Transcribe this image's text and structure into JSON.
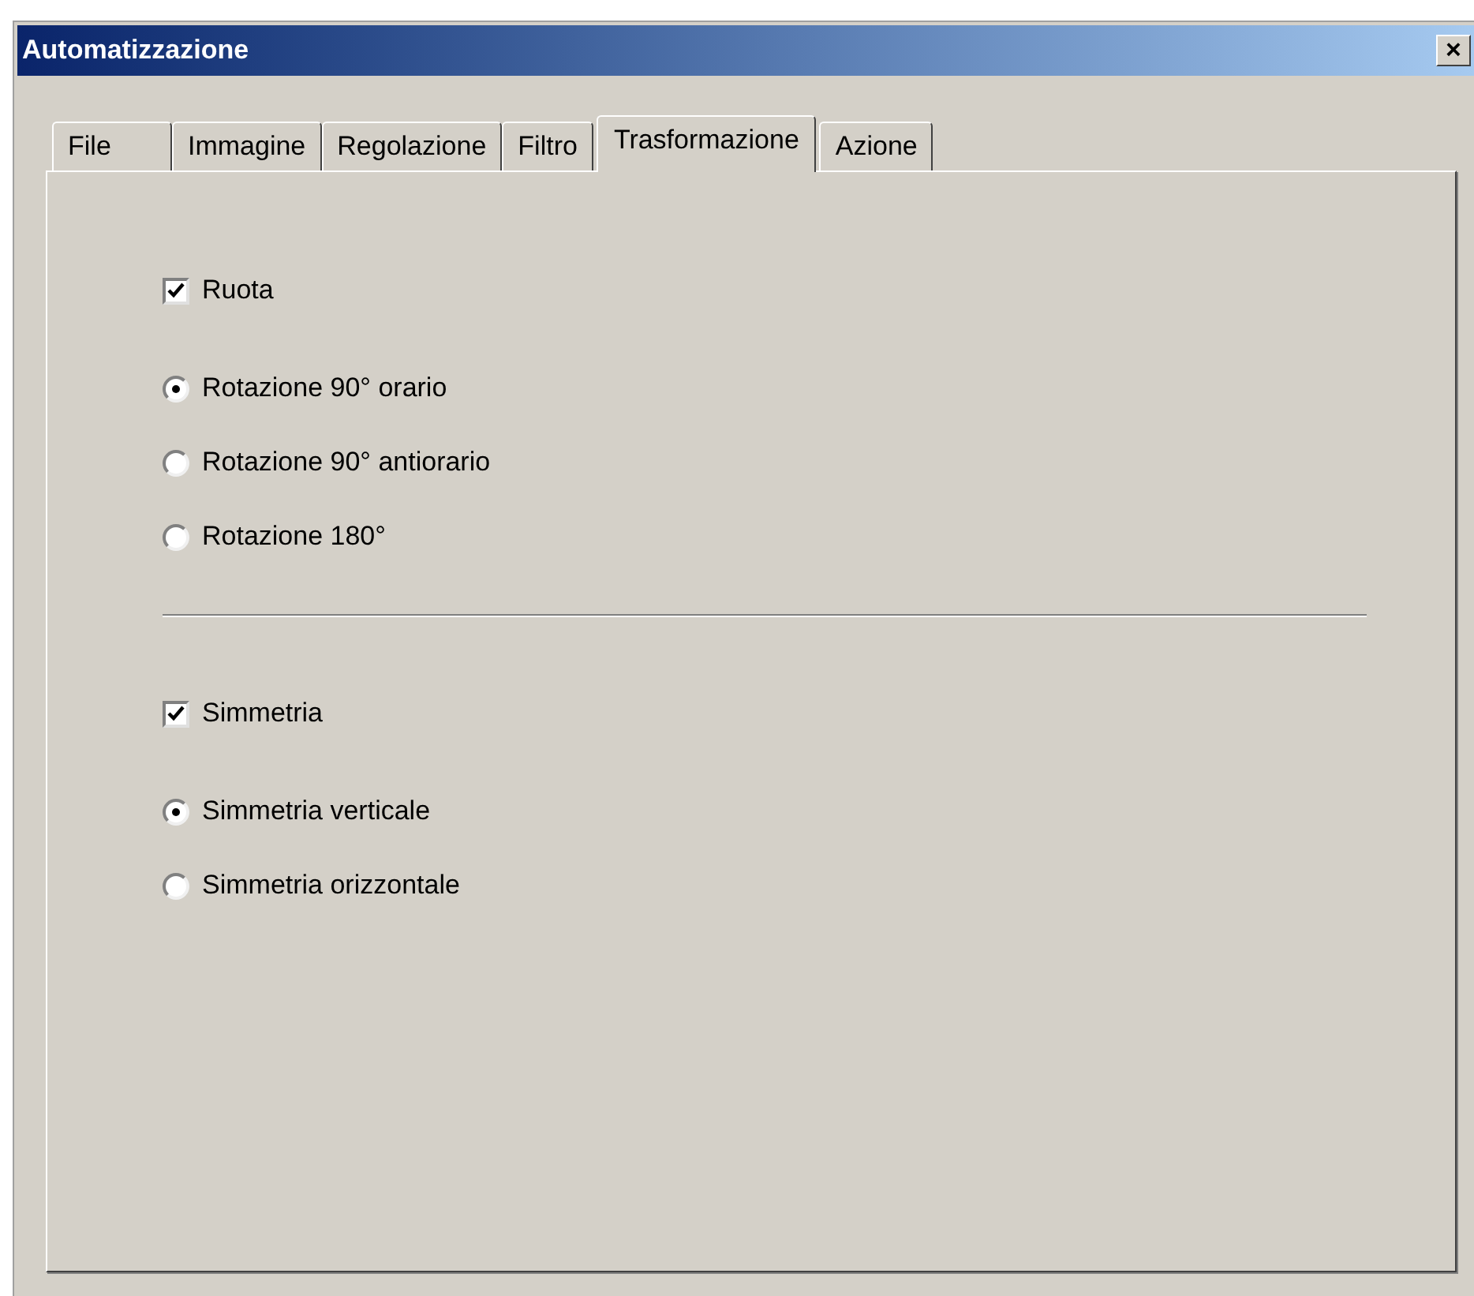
{
  "window": {
    "title": "Automatizzazione",
    "close": "×"
  },
  "tabs": [
    {
      "label": "File",
      "selected": false
    },
    {
      "label": "Immagine",
      "selected": false
    },
    {
      "label": "Regolazione",
      "selected": false
    },
    {
      "label": "Filtro",
      "selected": false
    },
    {
      "label": "Trasformazione",
      "selected": true
    },
    {
      "label": "Azione",
      "selected": false
    }
  ],
  "groups": [
    {
      "checkbox": {
        "label": "Ruota",
        "checked": true
      },
      "options": [
        {
          "label": "Rotazione 90° orario",
          "selected": true
        },
        {
          "label": "Rotazione 90° antiorario",
          "selected": false
        },
        {
          "label": "Rotazione 180°",
          "selected": false
        }
      ]
    },
    {
      "checkbox": {
        "label": "Simmetria",
        "checked": true
      },
      "options": [
        {
          "label": "Simmetria verticale",
          "selected": true
        },
        {
          "label": "Simmetria orizzontale",
          "selected": false
        }
      ]
    }
  ]
}
